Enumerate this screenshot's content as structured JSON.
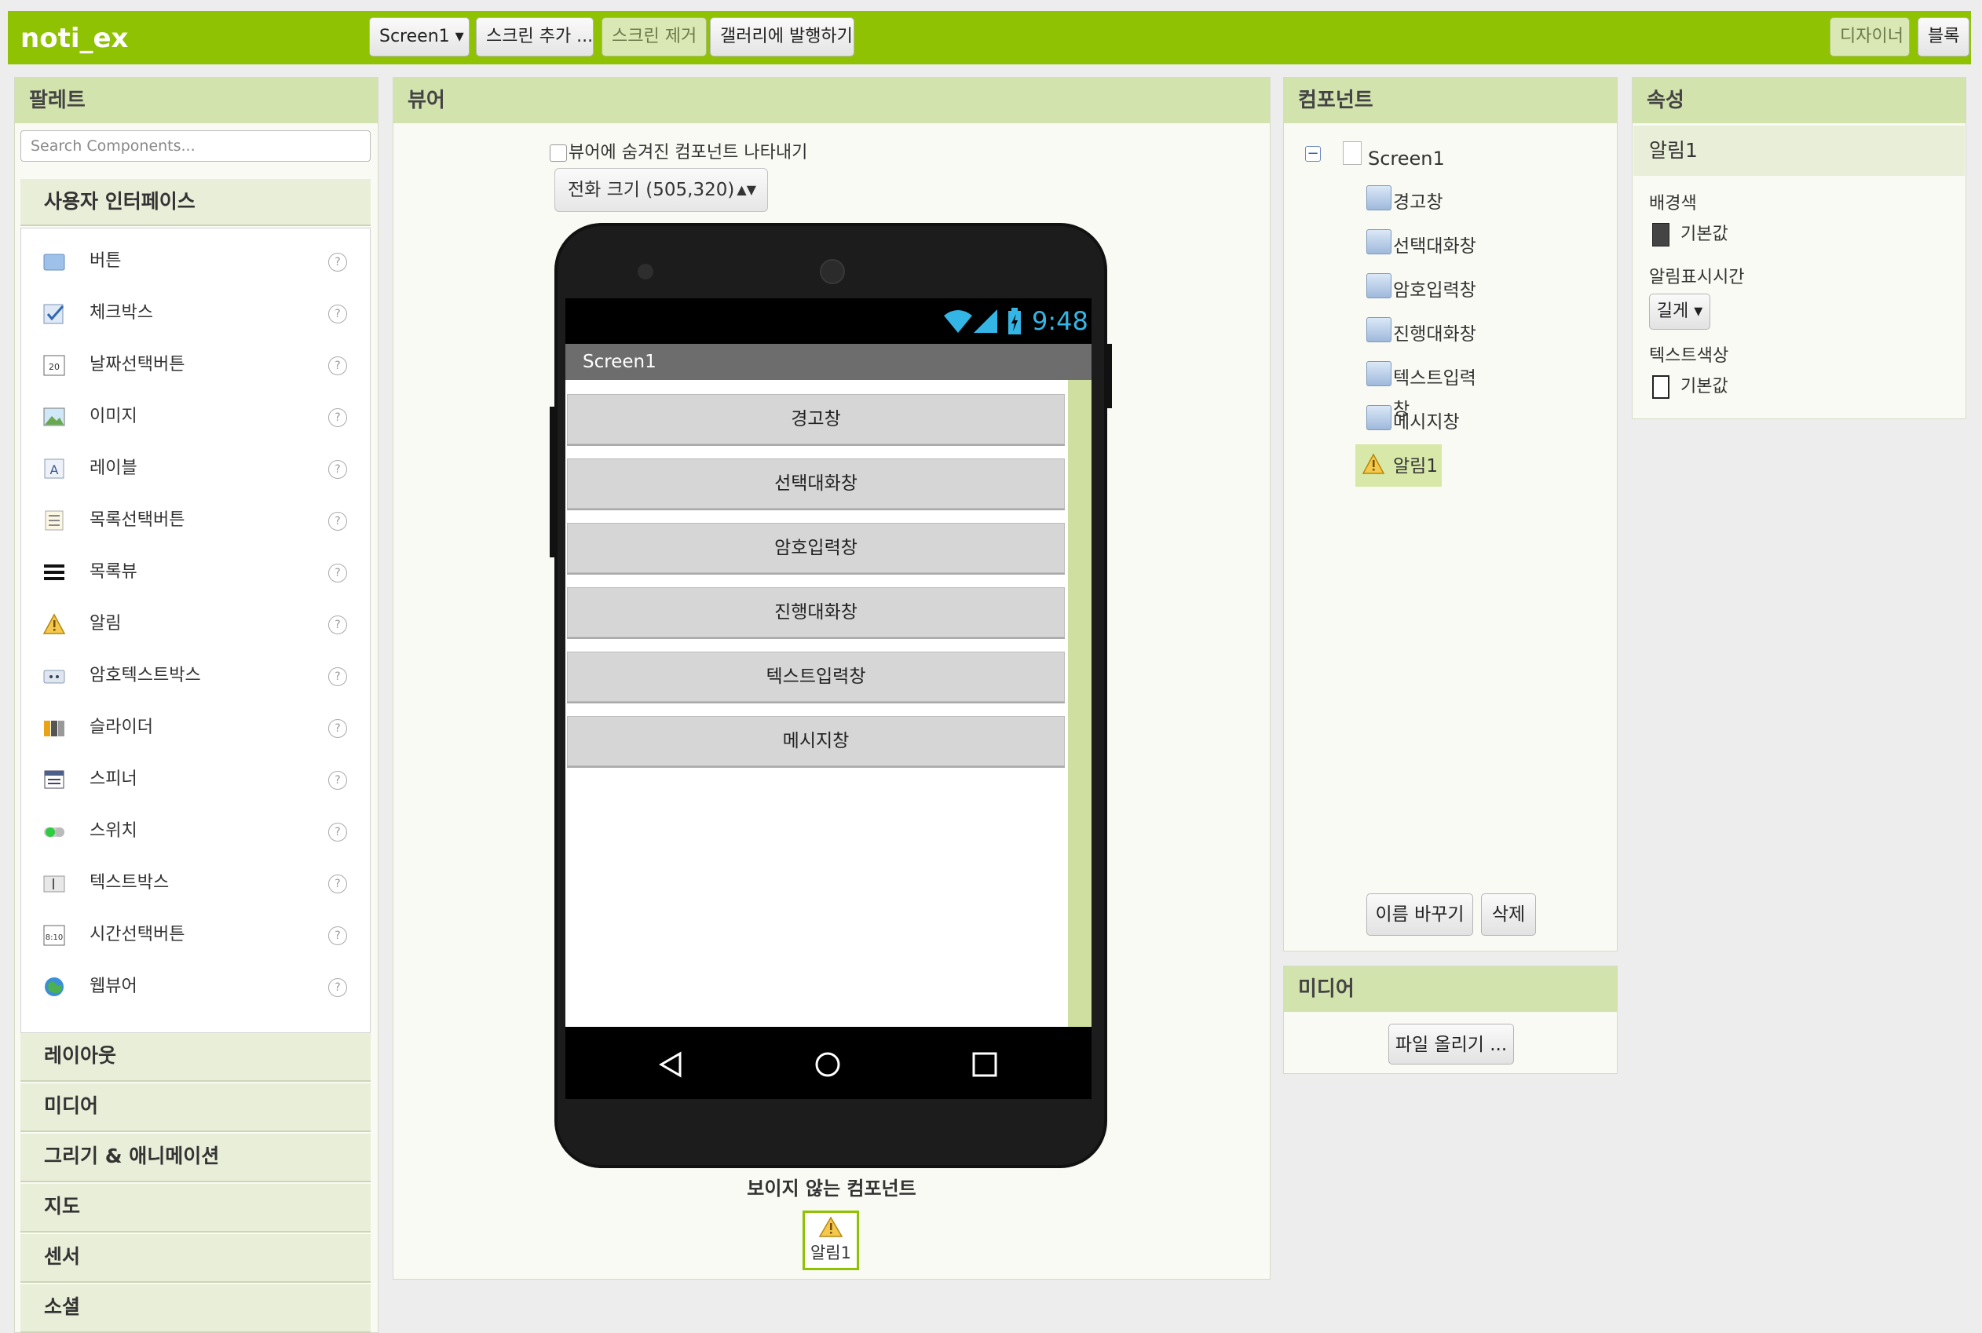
{
  "app": {
    "title": "noti_ex"
  },
  "toolbar": {
    "screen_select": "Screen1 ▾",
    "add_screen": "스크린 추가 ...",
    "remove_screen": "스크린 제거",
    "publish_gallery": "갤러리에 발행하기",
    "designer": "디자이너",
    "blocks": "블록"
  },
  "palette": {
    "title": "팔레트",
    "search_placeholder": "Search Components...",
    "section_ui": "사용자 인터페이스",
    "items": [
      {
        "label": "버튼",
        "icon": "button-icon"
      },
      {
        "label": "체크박스",
        "icon": "checkbox-icon"
      },
      {
        "label": "날짜선택버튼",
        "icon": "date-picker-icon"
      },
      {
        "label": "이미지",
        "icon": "image-icon"
      },
      {
        "label": "레이블",
        "icon": "label-icon"
      },
      {
        "label": "목록선택버튼",
        "icon": "list-picker-icon"
      },
      {
        "label": "목록뷰",
        "icon": "list-view-icon"
      },
      {
        "label": "알림",
        "icon": "notifier-icon"
      },
      {
        "label": "암호텍스트박스",
        "icon": "password-textbox-icon"
      },
      {
        "label": "슬라이더",
        "icon": "slider-icon"
      },
      {
        "label": "스피너",
        "icon": "spinner-icon"
      },
      {
        "label": "스위치",
        "icon": "switch-icon"
      },
      {
        "label": "텍스트박스",
        "icon": "textbox-icon"
      },
      {
        "label": "시간선택버튼",
        "icon": "time-picker-icon"
      },
      {
        "label": "웹뷰어",
        "icon": "web-viewer-icon"
      }
    ],
    "help": "?",
    "categories": [
      "레이아웃",
      "미디어",
      "그리기 & 애니메이션",
      "지도",
      "센서",
      "소셜"
    ]
  },
  "viewer": {
    "title": "뷰어",
    "show_hidden": "뷰어에 숨겨진 컴포넌트 나타내기",
    "size_select": "전화 크기 (505,320)",
    "status_time": "9:48",
    "screen_title": "Screen1",
    "buttons": [
      "경고창",
      "선택대화창",
      "암호입력창",
      "진행대화창",
      "텍스트입력창",
      "메시지창"
    ],
    "nonvisible_title": "보이지 않는 컴포넌트",
    "nonvisible_item": "알림1"
  },
  "components": {
    "title": "컴포넌트",
    "collapse": "−",
    "root": "Screen1",
    "children": [
      "경고창",
      "선택대화창",
      "암호입력창",
      "진행대화창",
      "텍스트입력창",
      "메시지창",
      "알림1"
    ],
    "selected": "알림1",
    "rename": "이름 바꾸기",
    "delete": "삭제"
  },
  "media": {
    "title": "미디어",
    "upload": "파일 올리기 ..."
  },
  "properties": {
    "title": "속성",
    "component": "알림1",
    "bg_label": "배경색",
    "bg_value": "기본값",
    "duration_label": "알림표시시간",
    "duration_value": "길게 ▾",
    "text_color_label": "텍스트색상",
    "text_color_value": "기본값"
  },
  "colors": {
    "accent": "#8fc202",
    "panel_header": "#d3e3ad",
    "selected": "#d8e8a8"
  }
}
